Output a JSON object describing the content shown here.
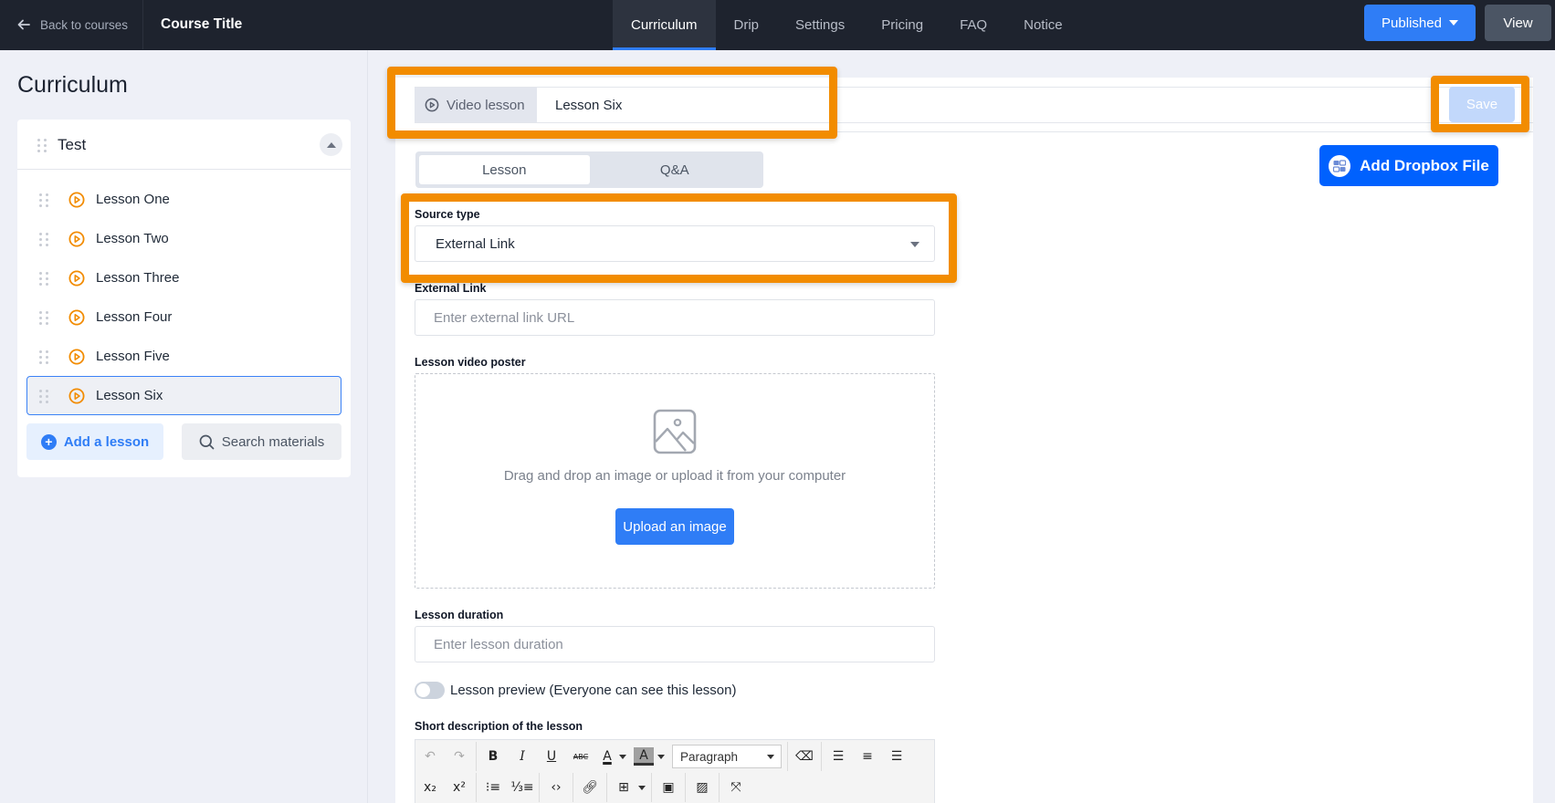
{
  "topbar": {
    "back_label": "Back to courses",
    "course_title": "Course Title",
    "tabs": [
      {
        "label": "Curriculum",
        "active": true
      },
      {
        "label": "Drip",
        "active": false
      },
      {
        "label": "Settings",
        "active": false
      },
      {
        "label": "Pricing",
        "active": false
      },
      {
        "label": "FAQ",
        "active": false
      },
      {
        "label": "Notice",
        "active": false
      }
    ],
    "published_label": "Published",
    "view_label": "View"
  },
  "sidebar": {
    "heading": "Curriculum",
    "section": {
      "title": "Test",
      "lessons": [
        {
          "label": "Lesson One",
          "icon": "play-circle-icon",
          "active": false
        },
        {
          "label": "Lesson Two",
          "icon": "play-circle-icon",
          "active": false
        },
        {
          "label": "Lesson Three",
          "icon": "play-circle-icon",
          "active": false
        },
        {
          "label": "Lesson Four",
          "icon": "play-circle-icon",
          "active": false
        },
        {
          "label": "Lesson Five",
          "icon": "play-circle-icon",
          "active": false
        },
        {
          "label": "Lesson Six",
          "icon": "play-circle-icon",
          "active": true
        }
      ]
    },
    "add_lesson_label": "Add a lesson",
    "search_materials_label": "Search materials"
  },
  "editor": {
    "lesson_type_label": "Video lesson",
    "lesson_title_value": "Lesson Six",
    "save_label": "Save",
    "tabs": [
      {
        "label": "Lesson",
        "active": true
      },
      {
        "label": "Q&A",
        "active": false
      }
    ],
    "dropbox_label": "Add Dropbox File",
    "source_type": {
      "label": "Source type",
      "value": "External Link"
    },
    "external_link": {
      "label": "External Link",
      "placeholder": "Enter external link URL",
      "value": ""
    },
    "poster": {
      "label": "Lesson video poster",
      "hint": "Drag and drop an image or upload it from your computer",
      "upload_label": "Upload an image"
    },
    "duration": {
      "label": "Lesson duration",
      "placeholder": "Enter lesson duration",
      "value": ""
    },
    "preview_toggle": {
      "label": "Lesson preview (Everyone can see this lesson)",
      "on": false
    },
    "description": {
      "label": "Short description of the lesson",
      "format_select": "Paragraph"
    }
  },
  "colors": {
    "accent": "#2f7df6",
    "topbar_bg": "#1e232e",
    "highlight": "#f28c00",
    "dropbox": "#0061fe",
    "lesson_icon": "#f28c00"
  }
}
